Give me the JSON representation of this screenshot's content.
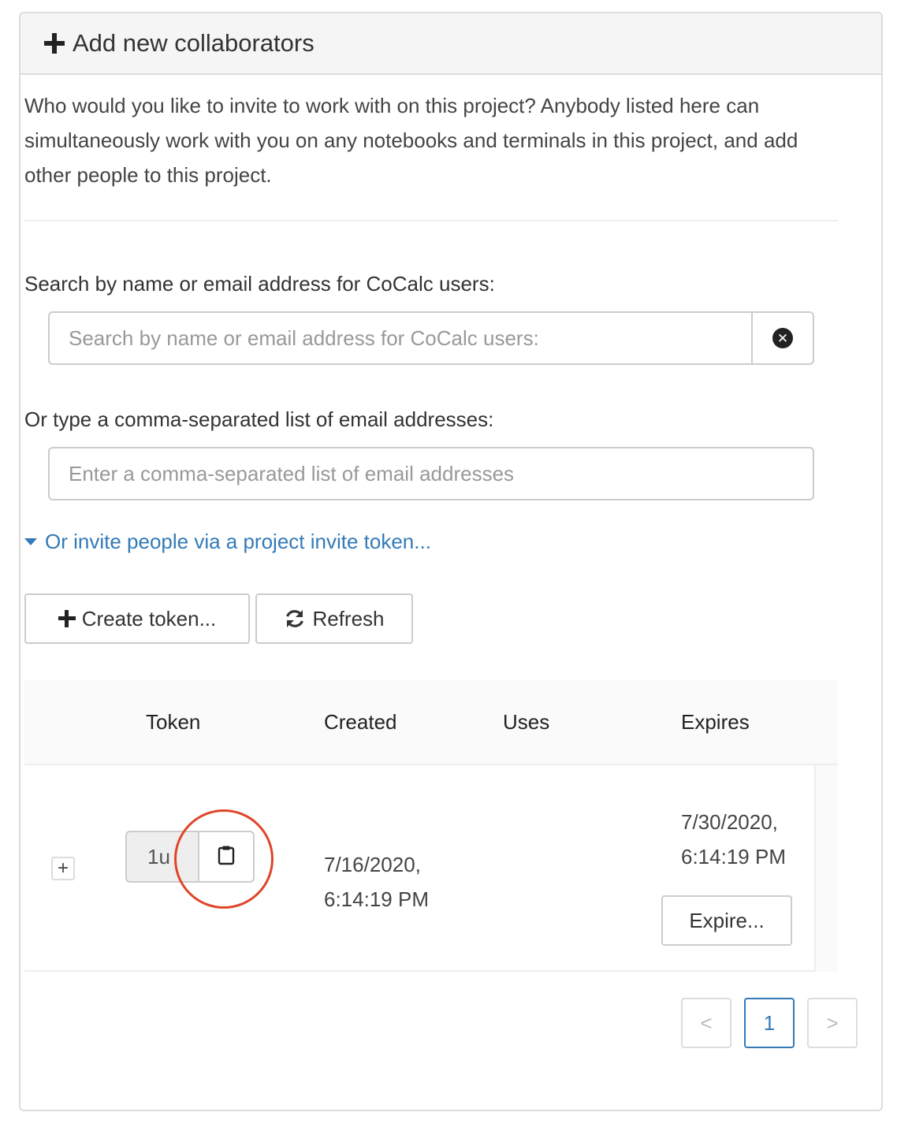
{
  "panel": {
    "title": "Add new collaborators",
    "intro": "Who would you like to invite to work with on this project? Anybody listed here can simultaneously work with you on any notebooks and terminals in this project, and add other people to this project."
  },
  "search": {
    "label": "Search by name or email address for CoCalc users:",
    "placeholder": "Search by name or email address for CoCalc users:",
    "value": ""
  },
  "emails": {
    "label": "Or type a comma-separated list of email addresses:",
    "placeholder": "Enter a comma-separated list of email addresses",
    "value": ""
  },
  "invite_link": "Or invite people via a project invite token...",
  "buttons": {
    "create_token": "Create token...",
    "refresh": "Refresh"
  },
  "table": {
    "headers": [
      "Token",
      "Created",
      "Uses",
      "Expires"
    ],
    "rows": [
      {
        "expand": "+",
        "token": "1u",
        "created_date": "7/16/2020,",
        "created_time": "6:14:19 PM",
        "uses": "",
        "expires_date": "7/30/2020,",
        "expires_time": "6:14:19 PM",
        "expire_button": "Expire..."
      }
    ]
  },
  "pagination": {
    "prev": "<",
    "current_page": "1",
    "next": ">"
  },
  "colors": {
    "link": "#337ab7",
    "highlight": "#e0452a",
    "border": "#dddddd"
  },
  "icons": {
    "heading": "plus-icon",
    "clear": "close-circle-icon",
    "invite_toggle": "caret-down-icon",
    "create": "plus-icon",
    "refresh": "refresh-icon",
    "copy": "clipboard-icon"
  }
}
